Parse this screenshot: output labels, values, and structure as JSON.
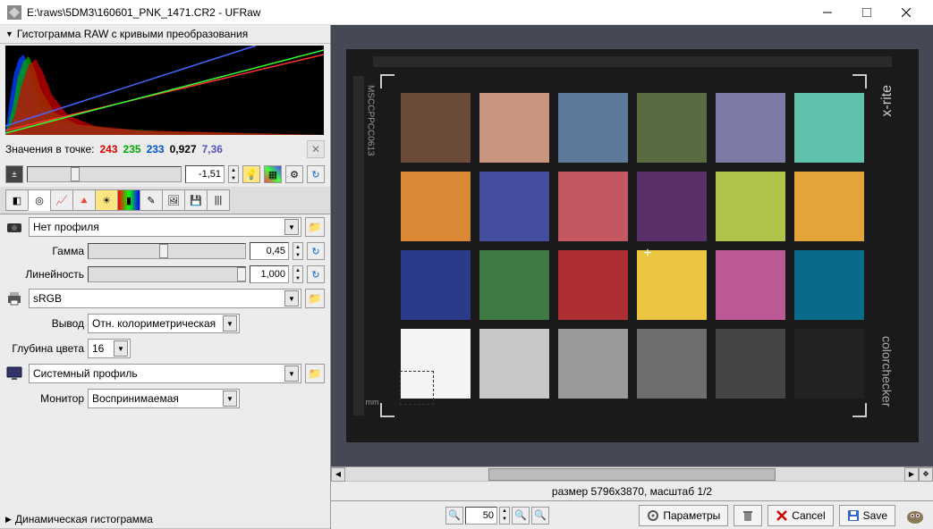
{
  "window": {
    "title": "E:\\raws\\5DM3\\160601_PNK_1471.CR2 - UFRaw"
  },
  "histogram_section": {
    "title": "Гистограмма RAW с кривыми преобразования"
  },
  "spot": {
    "label": "Значения в точке:",
    "r": "243",
    "g": "235",
    "b": "233",
    "ev": "0,927",
    "temp": "7,36"
  },
  "exposure": {
    "value": "-1,51"
  },
  "profiles": {
    "input": "Нет профиля",
    "gamma_label": "Гамма",
    "gamma_value": "0,45",
    "linearity_label": "Линейность",
    "linearity_value": "1,000",
    "output": "sRGB",
    "intent_label": "Вывод",
    "intent_value": "Отн. колориметрическая",
    "depth_label": "Глубина цвета",
    "depth_value": "16",
    "display": "Системный профиль",
    "monitor_label": "Монитор",
    "monitor_value": "Воспринимаемая"
  },
  "dyn_hist": {
    "title": "Динамическая гистограмма"
  },
  "preview": {
    "serial": "MSCCPPCC0613",
    "mm": "mm",
    "brand1": "x-rite",
    "brand2": "colorchecker",
    "swatches": [
      "#6b4a3a",
      "#c79580",
      "#5e7a9a",
      "#596b40",
      "#7c7ba6",
      "#5fc0ab",
      "#da8a34",
      "#454d9e",
      "#c35762",
      "#593069",
      "#aec448",
      "#e4a43a",
      "#2b3b8a",
      "#3f7a45",
      "#ad2f33",
      "#ecc642",
      "#bb5a94",
      "#0a6a8a",
      "#f4f4f4",
      "#c8c8c8",
      "#9a9a9a",
      "#6e6e6e",
      "#444444",
      "#222222"
    ],
    "info": "размер 5796x3870, масштаб 1/2"
  },
  "zoom": {
    "value": "50"
  },
  "buttons": {
    "options": "Параметры",
    "cancel": "Cancel",
    "save": "Save"
  }
}
